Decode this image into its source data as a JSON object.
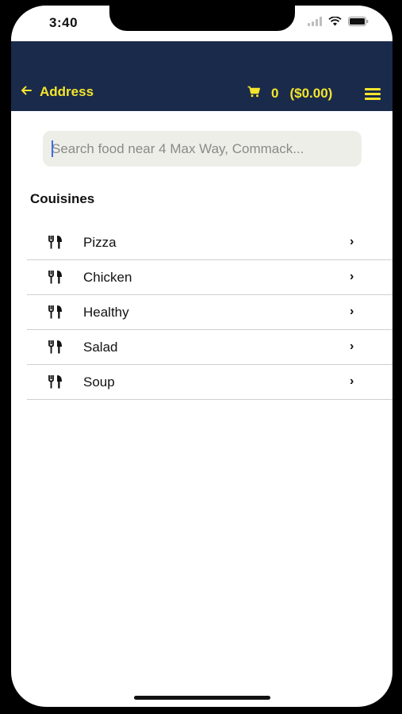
{
  "status_bar": {
    "time": "3:40"
  },
  "header": {
    "title": "Address",
    "cart_count": "0",
    "cart_total": "($0.00)",
    "colors": {
      "background": "#1a2a4b",
      "accent": "#f4e52c"
    },
    "icons": [
      "back-arrow-icon",
      "cart-icon",
      "menu-icon"
    ]
  },
  "search": {
    "placeholder": "Search food near 4 Max Way, Commack...",
    "value": ""
  },
  "cuisines": {
    "title": "Couisines",
    "items": [
      {
        "label": "Pizza",
        "icon": "fork-knife-icon"
      },
      {
        "label": "Chicken",
        "icon": "fork-knife-icon"
      },
      {
        "label": "Healthy",
        "icon": "fork-knife-icon"
      },
      {
        "label": "Salad",
        "icon": "fork-knife-icon"
      },
      {
        "label": "Soup",
        "icon": "fork-knife-icon"
      }
    ]
  }
}
